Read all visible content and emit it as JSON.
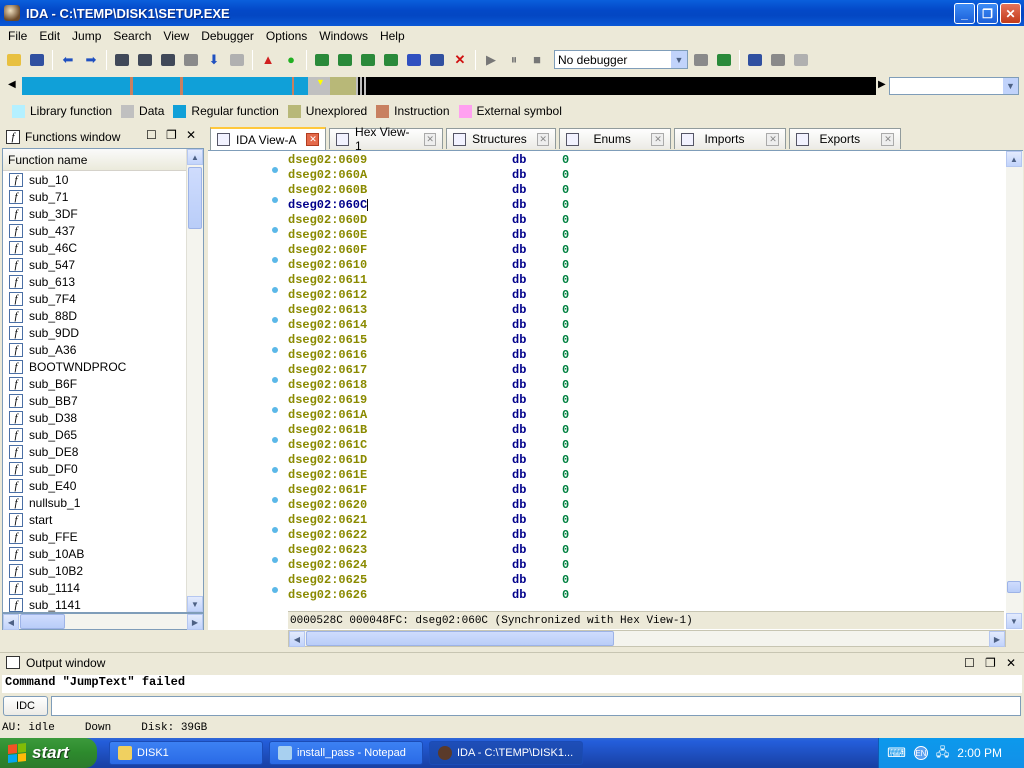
{
  "window": {
    "title": "IDA - C:\\TEMP\\DISK1\\SETUP.EXE",
    "min": "_",
    "max": "❐",
    "close": "✕"
  },
  "menu": [
    "File",
    "Edit",
    "Jump",
    "Search",
    "View",
    "Debugger",
    "Options",
    "Windows",
    "Help"
  ],
  "toolbar": {
    "debugger_select": "No debugger"
  },
  "legend": [
    {
      "label": "Library function",
      "color": "#b4f0ff"
    },
    {
      "label": "Data",
      "color": "#c0c0c0"
    },
    {
      "label": "Regular function",
      "color": "#10a0d8"
    },
    {
      "label": "Unexplored",
      "color": "#b8b878"
    },
    {
      "label": "Instruction",
      "color": "#c88060"
    },
    {
      "label": "External symbol",
      "color": "#ffa0f0"
    }
  ],
  "functions_window": {
    "title": "Functions window",
    "column": "Function name",
    "items": [
      "sub_10",
      "sub_71",
      "sub_3DF",
      "sub_437",
      "sub_46C",
      "sub_547",
      "sub_613",
      "sub_7F4",
      "sub_88D",
      "sub_9DD",
      "sub_A36",
      "BOOTWNDPROC",
      "sub_B6F",
      "sub_BB7",
      "sub_D38",
      "sub_D65",
      "sub_DE8",
      "sub_DF0",
      "sub_E40",
      "nullsub_1",
      "start",
      "sub_FFE",
      "sub_10AB",
      "sub_10B2",
      "sub_1114",
      "sub_1141"
    ]
  },
  "tabs": [
    {
      "label": "IDA View-A",
      "active": true
    },
    {
      "label": "Hex View-1"
    },
    {
      "label": "Structures"
    },
    {
      "label": "Enums"
    },
    {
      "label": "Imports"
    },
    {
      "label": "Exports"
    }
  ],
  "disasm": {
    "lines": [
      {
        "addr": "dseg02:0609",
        "mn": "db",
        "val": "0"
      },
      {
        "addr": "dseg02:060A",
        "mn": "db",
        "val": "0"
      },
      {
        "addr": "dseg02:060B",
        "mn": "db",
        "val": "0"
      },
      {
        "addr": "dseg02:060C",
        "mn": "db",
        "val": "0",
        "current": true
      },
      {
        "addr": "dseg02:060D",
        "mn": "db",
        "val": "0"
      },
      {
        "addr": "dseg02:060E",
        "mn": "db",
        "val": "0"
      },
      {
        "addr": "dseg02:060F",
        "mn": "db",
        "val": "0"
      },
      {
        "addr": "dseg02:0610",
        "mn": "db",
        "val": "0"
      },
      {
        "addr": "dseg02:0611",
        "mn": "db",
        "val": "0"
      },
      {
        "addr": "dseg02:0612",
        "mn": "db",
        "val": "0"
      },
      {
        "addr": "dseg02:0613",
        "mn": "db",
        "val": "0"
      },
      {
        "addr": "dseg02:0614",
        "mn": "db",
        "val": "0"
      },
      {
        "addr": "dseg02:0615",
        "mn": "db",
        "val": "0"
      },
      {
        "addr": "dseg02:0616",
        "mn": "db",
        "val": "0"
      },
      {
        "addr": "dseg02:0617",
        "mn": "db",
        "val": "0"
      },
      {
        "addr": "dseg02:0618",
        "mn": "db",
        "val": "0"
      },
      {
        "addr": "dseg02:0619",
        "mn": "db",
        "val": "0"
      },
      {
        "addr": "dseg02:061A",
        "mn": "db",
        "val": "0"
      },
      {
        "addr": "dseg02:061B",
        "mn": "db",
        "val": "0"
      },
      {
        "addr": "dseg02:061C",
        "mn": "db",
        "val": "0"
      },
      {
        "addr": "dseg02:061D",
        "mn": "db",
        "val": "0"
      },
      {
        "addr": "dseg02:061E",
        "mn": "db",
        "val": "0"
      },
      {
        "addr": "dseg02:061F",
        "mn": "db",
        "val": "0"
      },
      {
        "addr": "dseg02:0620",
        "mn": "db",
        "val": "0"
      },
      {
        "addr": "dseg02:0621",
        "mn": "db",
        "val": "0"
      },
      {
        "addr": "dseg02:0622",
        "mn": "db",
        "val": "0"
      },
      {
        "addr": "dseg02:0623",
        "mn": "db",
        "val": "0"
      },
      {
        "addr": "dseg02:0624",
        "mn": "db",
        "val": "0"
      },
      {
        "addr": "dseg02:0625",
        "mn": "db",
        "val": "0"
      },
      {
        "addr": "dseg02:0626",
        "mn": "db",
        "val": "0"
      }
    ],
    "status": "0000528C 000048FC: dseg02:060C (Synchronized with Hex View-1)"
  },
  "output": {
    "title": "Output window",
    "text": "Command \"JumpText\" failed",
    "idc_button": "IDC"
  },
  "ida_status": {
    "au": "AU:  idle",
    "dir": "Down",
    "disk": "Disk: 39GB"
  },
  "taskbar": {
    "start": "start",
    "tasks": [
      {
        "label": "DISK1"
      },
      {
        "label": "install_pass - Notepad"
      },
      {
        "label": "IDA - C:\\TEMP\\DISK1...",
        "active": true
      }
    ],
    "clock": "2:00 PM"
  }
}
